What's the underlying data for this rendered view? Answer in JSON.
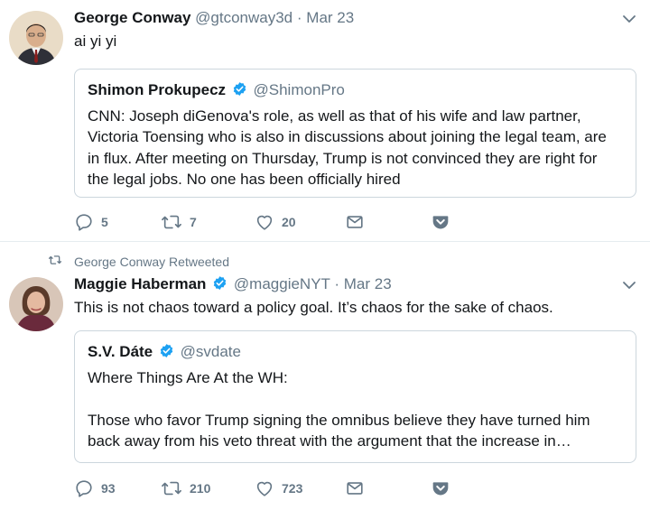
{
  "tweets": [
    {
      "author": {
        "name": "George Conway",
        "handle": "@gtconway3d",
        "verified": false
      },
      "separator": "·",
      "date": "Mar 23",
      "text": "ai yi yi",
      "quote": {
        "name": "Shimon Prokupecz",
        "handle": "@ShimonPro",
        "verified": true,
        "lines": [
          "CNN: Joseph diGenova's role, as well as that of his wife and law partner,",
          "Victoria Toensing who is also in discussions about joining the legal team, are",
          "in flux. After meeting on Thursday, Trump is not convinced they are right for",
          "the legal jobs. No one has been officially hired"
        ]
      },
      "actions": {
        "replies": "5",
        "retweets": "7",
        "likes": "20"
      }
    },
    {
      "retweet_context": "George Conway Retweeted",
      "author": {
        "name": "Maggie Haberman",
        "handle": "@maggieNYT",
        "verified": true
      },
      "separator": "·",
      "date": "Mar 23",
      "text": "This is not chaos toward a policy goal. It’s chaos for the sake of chaos.",
      "quote": {
        "name": "S.V. Dáte",
        "handle": "@svdate",
        "verified": true,
        "lines": [
          "Where Things Are At the WH:",
          "",
          "Those who favor Trump signing the omnibus believe they have turned him",
          "back away from his veto threat with the argument that the increase in…"
        ]
      },
      "actions": {
        "replies": "93",
        "retweets": "210",
        "likes": "723"
      }
    }
  ],
  "colors": {
    "text": "#14171a",
    "secondary": "#657786",
    "verified": "#1da1f2",
    "border": "#ccd6dd",
    "divider": "#e6ecf0"
  },
  "icons": {
    "reply": "reply-icon",
    "retweet": "retweet-icon",
    "like": "heart-icon",
    "dm": "envelope-icon",
    "pocket": "pocket-icon",
    "caret": "chevron-down-icon",
    "verified": "verified-badge-icon"
  }
}
